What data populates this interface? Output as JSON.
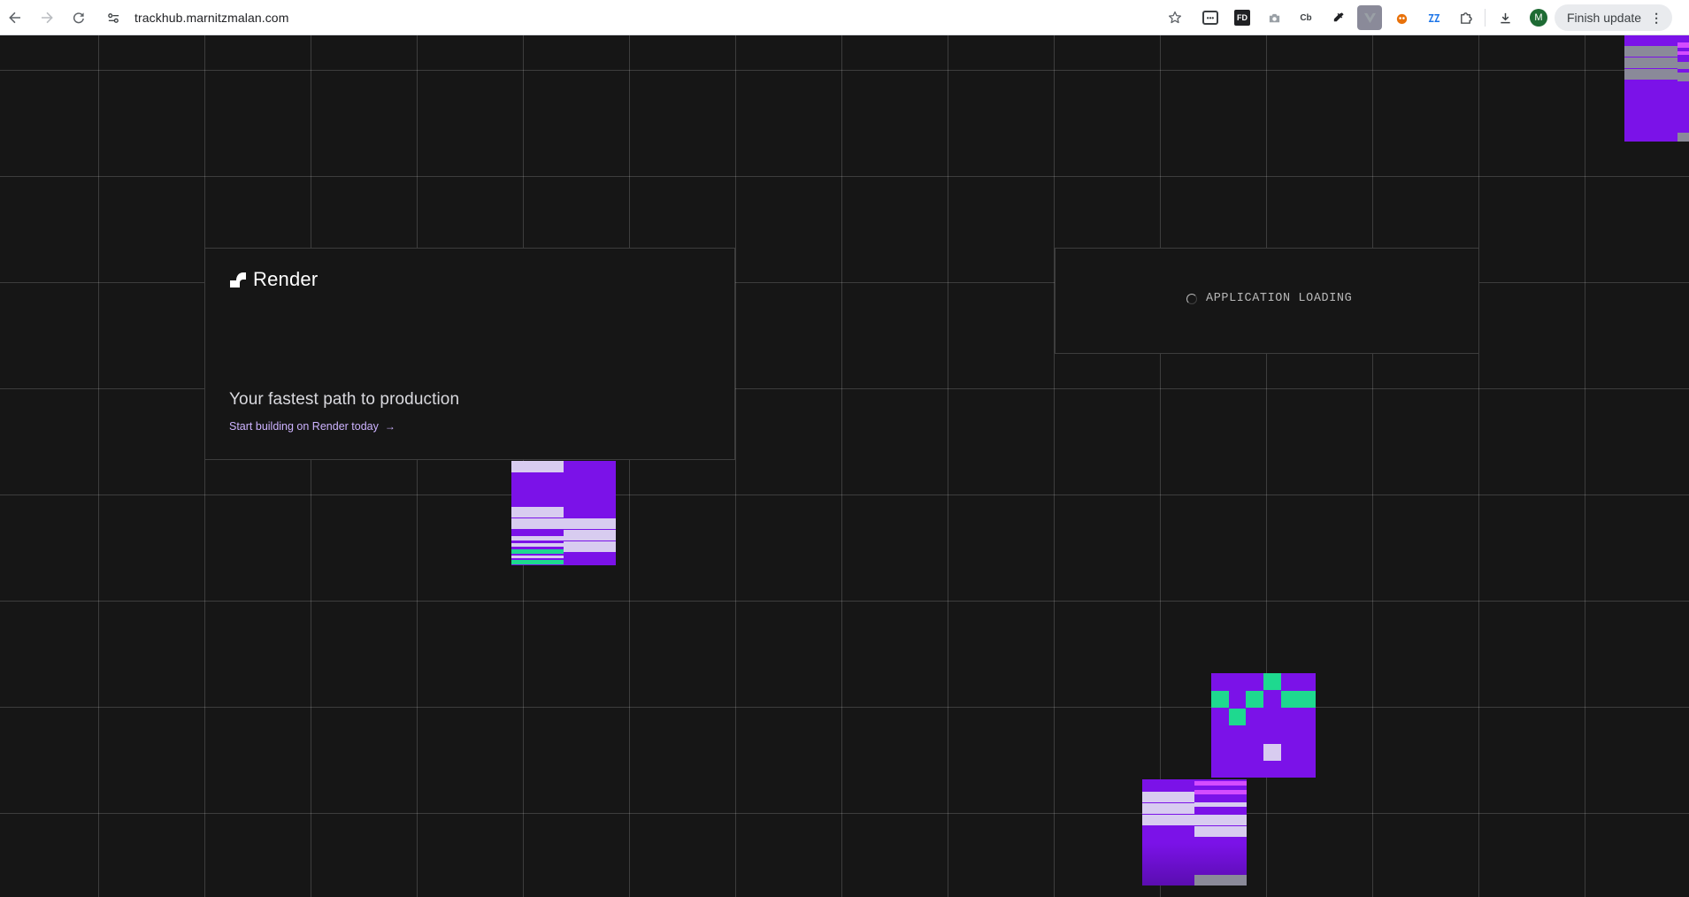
{
  "browser": {
    "url": "trackhub.marnitzmalan.com",
    "extensions": [
      "box-ext-icon",
      "fd-ext-icon",
      "camera-ext-icon",
      "Cb",
      "eyedropper-ext-icon",
      "vue-ext-icon",
      "orange-ext-icon",
      "blue-ext-icon",
      "puzzle-extensions-icon"
    ],
    "extension_cb_label": "Cb",
    "extension_fd_label": "FD",
    "avatar_initial": "M",
    "update_label": "Finish update"
  },
  "page": {
    "brand": "Render",
    "tagline": "Your fastest path to production",
    "cta": "Start building on Render today",
    "cta_arrow": "→",
    "loading_text": "APPLICATION LOADING"
  },
  "colors": {
    "background": "#161616",
    "accent_purple": "#7b12e8",
    "accent_green": "#1ed98f",
    "cta_lavender": "#cdb3ff"
  }
}
